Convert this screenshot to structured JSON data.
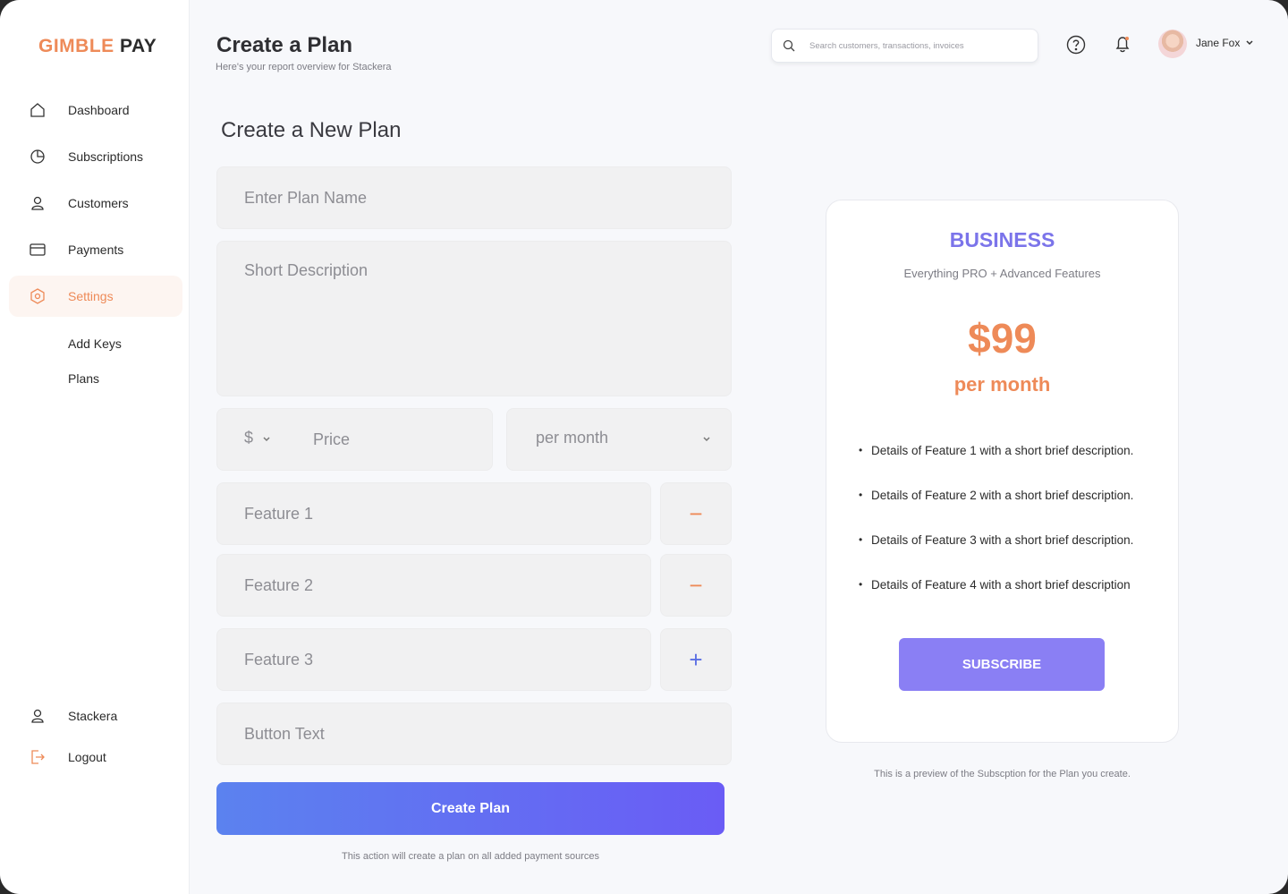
{
  "brand": {
    "part1": "GIMBLE",
    "part2": " PAY"
  },
  "sidebar": {
    "items": [
      {
        "label": "Dashboard",
        "icon": "home-icon"
      },
      {
        "label": "Subscriptions",
        "icon": "pie-chart-icon"
      },
      {
        "label": "Customers",
        "icon": "user-icon"
      },
      {
        "label": "Payments",
        "icon": "credit-card-icon"
      },
      {
        "label": "Settings",
        "icon": "settings-hex-icon",
        "active": true
      }
    ],
    "sub_items": [
      "Add Keys",
      "Plans"
    ],
    "bottom": [
      {
        "label": "Stackera",
        "icon": "user-icon"
      },
      {
        "label": "Logout",
        "icon": "logout-icon"
      }
    ]
  },
  "header": {
    "title": "Create a Plan",
    "subtitle": "Here's your report overview for Stackera",
    "search_placeholder": "Search customers, transactions, invoices",
    "user_name": "Jane Fox"
  },
  "form": {
    "title": "Create a New Plan",
    "plan_name_placeholder": "Enter Plan Name",
    "description_placeholder": "Short Description",
    "currency": "$",
    "price_placeholder": "Price",
    "period": "per month",
    "feature_placeholders": [
      "Feature 1",
      "Feature 2",
      "Feature 3"
    ],
    "feature_buttons": [
      "−",
      "−",
      "+"
    ],
    "button_text_placeholder": "Button Text",
    "submit_label": "Create Plan",
    "submit_note": "This action will create a plan on all added payment sources"
  },
  "preview": {
    "tier": "BUSINESS",
    "tier_desc": "Everything PRO + Advanced Features",
    "price": "$99",
    "period": "per month",
    "features": [
      "Details of Feature 1 with a short brief description.",
      "Details of Feature 2 with a short brief description.",
      "Details of Feature 3 with a short brief description.",
      "Details of Feature 4 with a short brief description"
    ],
    "button_label": "SUBSCRIBE",
    "note": "This is a preview of the Subscption for the Plan you create."
  },
  "colors": {
    "accent": "#ee8a58",
    "primary": "#6a5cf5",
    "purple": "#8a7ff4"
  }
}
